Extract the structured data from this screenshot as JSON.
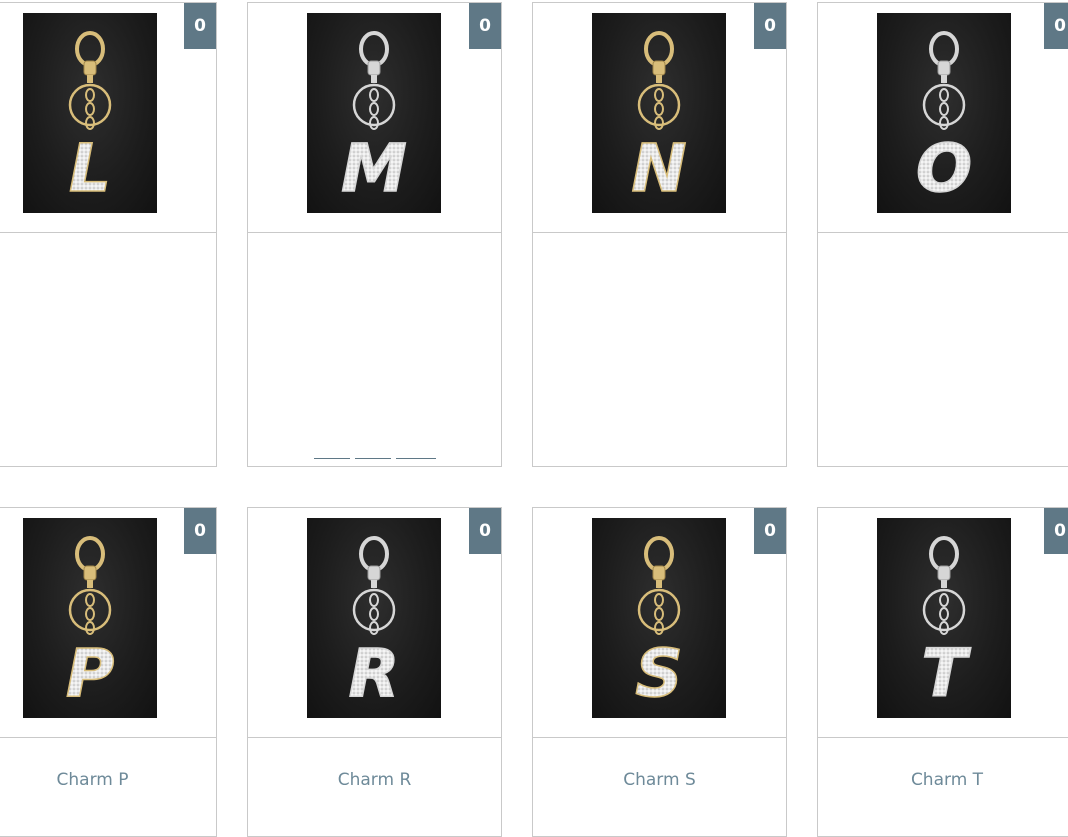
{
  "products": [
    {
      "letter": "L",
      "count": "0",
      "title": "",
      "metal": "gold"
    },
    {
      "letter": "M",
      "count": "0",
      "title": "",
      "metal": "silver"
    },
    {
      "letter": "N",
      "count": "0",
      "title": "",
      "metal": "gold"
    },
    {
      "letter": "O",
      "count": "0",
      "title": "",
      "metal": "silver"
    },
    {
      "letter": "P",
      "count": "0",
      "title": "Charm P",
      "metal": "gold"
    },
    {
      "letter": "R",
      "count": "0",
      "title": "Charm R",
      "metal": "silver"
    },
    {
      "letter": "S",
      "count": "0",
      "title": "Charm S",
      "metal": "gold"
    },
    {
      "letter": "T",
      "count": "0",
      "title": "Charm T",
      "metal": "silver"
    }
  ],
  "colors": {
    "badge": "#5f7886",
    "link": "#6e8a99",
    "border": "#c9c9c9",
    "gold": "#d8bd7a",
    "silver": "#d6d6d6",
    "photo_bg": "#1c1c1c"
  }
}
